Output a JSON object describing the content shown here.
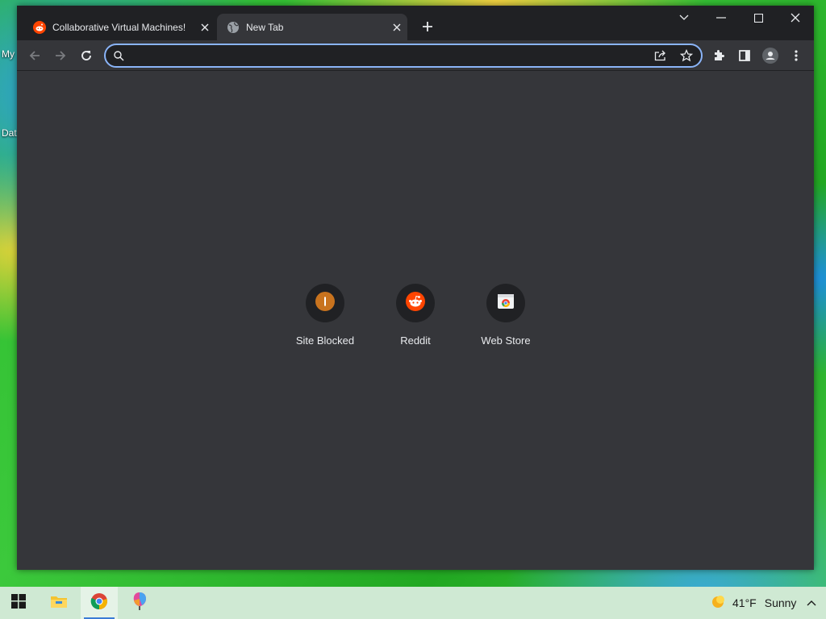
{
  "desktop": {
    "icon_labels": [
      "My",
      "Dat"
    ]
  },
  "browser": {
    "tabs": [
      {
        "title": "Collaborative Virtual Machines!",
        "favicon": "reddit-icon",
        "active": false
      },
      {
        "title": "New Tab",
        "favicon": "globe-icon",
        "active": true
      }
    ],
    "omnibox": {
      "value": "",
      "placeholder": ""
    },
    "accent_color": "#8ab4f8",
    "shortcuts": [
      {
        "label": "Site Blocked",
        "icon": "site-blocked-icon",
        "color": "#c8731e"
      },
      {
        "label": "Reddit",
        "icon": "reddit-icon",
        "color": "#ff4500"
      },
      {
        "label": "Web Store",
        "icon": "web-store-icon",
        "color": "#ffffff"
      }
    ]
  },
  "taskbar": {
    "apps": [
      "start-icon",
      "file-explorer-icon",
      "chrome-icon",
      "paint-icon"
    ],
    "weather": {
      "temperature": "41°F",
      "condition": "Sunny",
      "icon": "sun-icon"
    }
  }
}
